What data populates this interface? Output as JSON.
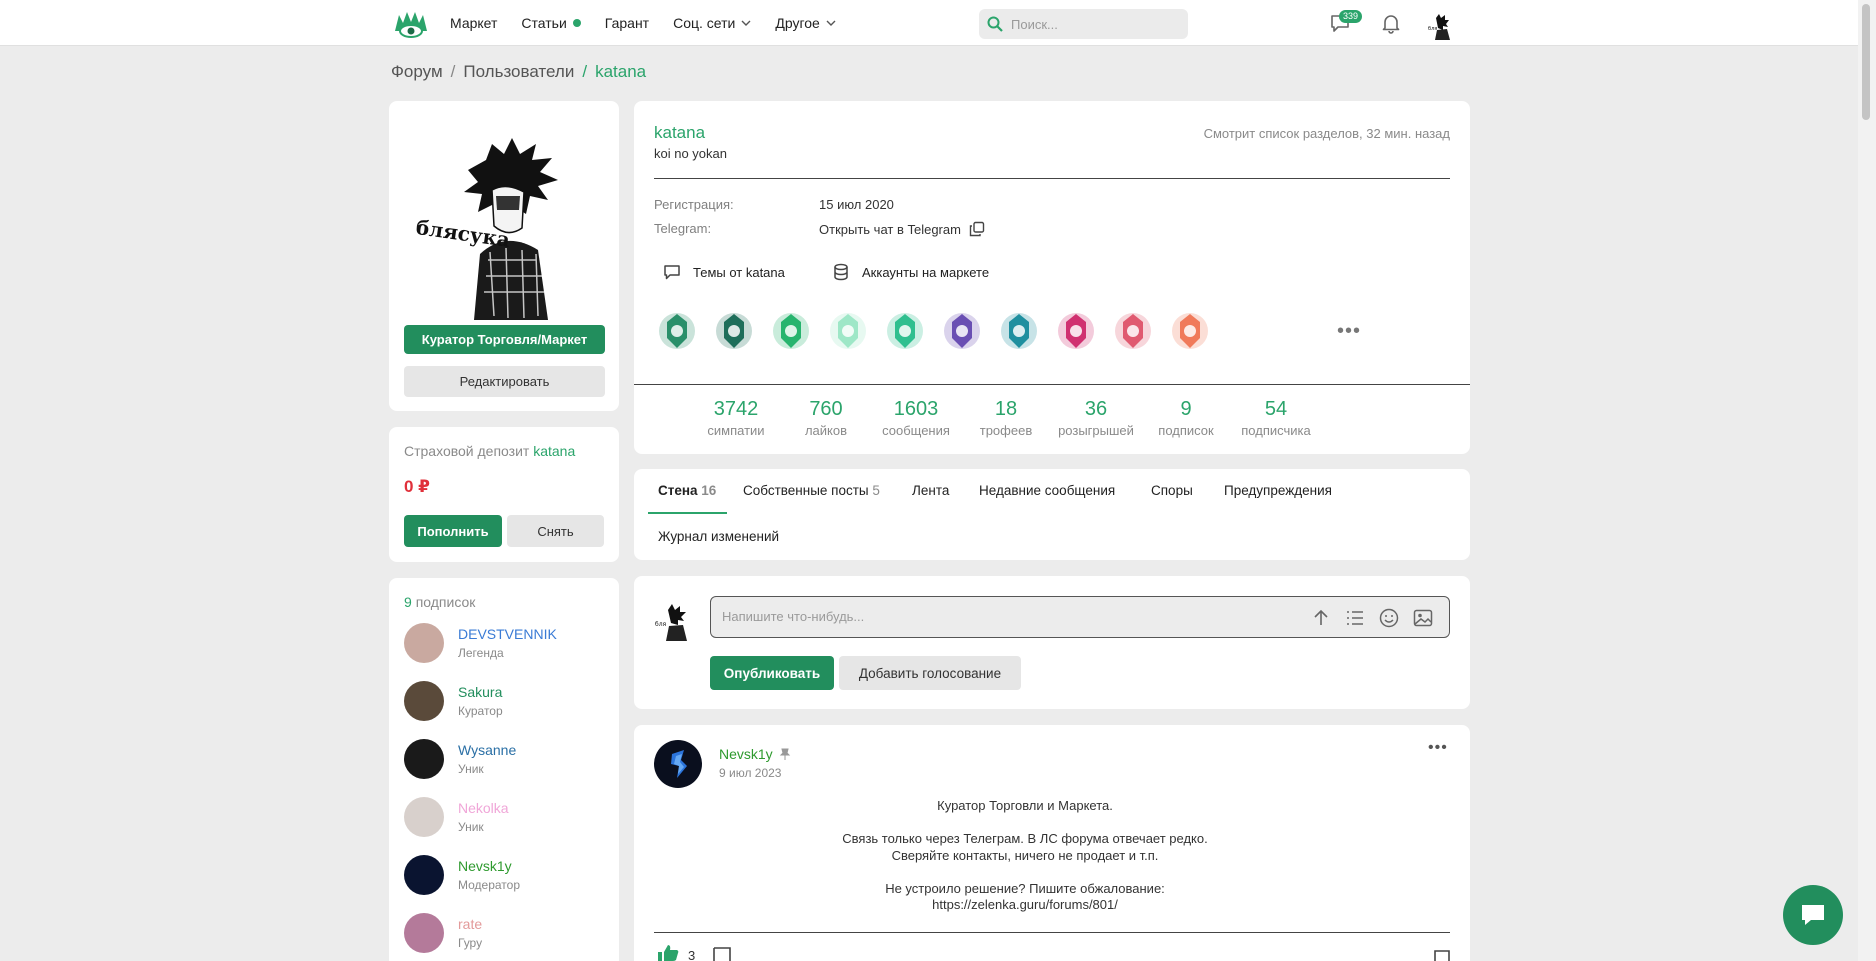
{
  "header": {
    "nav": [
      {
        "label": "Маркет",
        "dot": false,
        "chevron": false
      },
      {
        "label": "Статьи",
        "dot": true,
        "chevron": false
      },
      {
        "label": "Гарант",
        "dot": false,
        "chevron": false
      },
      {
        "label": "Соц. сети",
        "dot": false,
        "chevron": true
      },
      {
        "label": "Другое",
        "dot": false,
        "chevron": true
      }
    ],
    "search_placeholder": "Поиск...",
    "messages_badge": "339",
    "brand_color": "#2ba46b"
  },
  "breadcrumb": [
    "Форум",
    "/",
    "Пользователи",
    "/",
    "katana"
  ],
  "profile": {
    "username": "katana",
    "status": "koi no yokan",
    "activity": "Смотрит список разделов, 32 мин. назад",
    "role_button": "Куратор Торговля/Маркет",
    "edit_button": "Редактировать",
    "avatar_text": "блясука",
    "reg_label": "Регистрация:",
    "reg_value": "15 июл 2020",
    "tg_label": "Telegram:",
    "tg_value": "Открыть чат в Telegram",
    "link_topics": "Темы от katana",
    "link_market": "Аккаунты на маркете",
    "more": "•••"
  },
  "trophies": [
    {
      "name": "rainbow-six-trophy",
      "color": "#2a8f6a"
    },
    {
      "name": "year-trophy",
      "color": "#1e6e5a"
    },
    {
      "name": "three-years-trophy",
      "color": "#27b46e"
    },
    {
      "name": "lightbulb-trophy",
      "color": "#9ee7c7"
    },
    {
      "name": "drone-trophy",
      "color": "#2fbf8f"
    },
    {
      "name": "skull-trophy",
      "color": "#6a4fb3"
    },
    {
      "name": "planet-trophy",
      "color": "#1f8f9f"
    },
    {
      "name": "2k-trophy",
      "color": "#d03070"
    },
    {
      "name": "idea-trophy",
      "color": "#e05a70"
    },
    {
      "name": "flag-trophy",
      "color": "#f07a5a"
    }
  ],
  "stats": [
    {
      "value": "3742",
      "label": "симпатии"
    },
    {
      "value": "760",
      "label": "лайков"
    },
    {
      "value": "1603",
      "label": "сообщения"
    },
    {
      "value": "18",
      "label": "трофеев"
    },
    {
      "value": "36",
      "label": "розыгрышей"
    },
    {
      "value": "9",
      "label": "подписок"
    },
    {
      "value": "54",
      "label": "подписчика"
    }
  ],
  "deposit": {
    "title": "Страховой депозит",
    "user": "katana",
    "amount": "0 ₽",
    "topup": "Пополнить",
    "withdraw": "Снять"
  },
  "subscriptions": {
    "count": "9",
    "label": "подписок",
    "items": [
      {
        "name": "DEVSTVENNIK",
        "role": "Легенда",
        "color": "#3a7bd5",
        "av": "#c9a9a0"
      },
      {
        "name": "Sakura",
        "role": "Куратор",
        "color": "#228e5d",
        "av": "#5a4a3a"
      },
      {
        "name": "Wysanne",
        "role": "Уник",
        "color": "#2a6fa5",
        "av": "#1a1a1a"
      },
      {
        "name": "Nekolka",
        "role": "Уник",
        "color": "#f0a6d8",
        "av": "#d8d0cc"
      },
      {
        "name": "Nevsk1y",
        "role": "Модератор",
        "color": "#2e9a2e",
        "av": "#0a1430"
      },
      {
        "name": "rate",
        "role": "Гуру",
        "color": "#e39a9a",
        "av": "#b47a9a"
      }
    ]
  },
  "tabs": [
    {
      "label": "Стена",
      "count": "16",
      "active": true
    },
    {
      "label": "Собственные посты",
      "count": "5",
      "active": false
    },
    {
      "label": "Лента",
      "count": "",
      "active": false
    },
    {
      "label": "Недавние сообщения",
      "count": "",
      "active": false
    },
    {
      "label": "Споры",
      "count": "",
      "active": false
    },
    {
      "label": "Предупреждения",
      "count": "",
      "active": false
    },
    {
      "label": "Журнал изменений",
      "count": "",
      "active": false
    }
  ],
  "composer": {
    "placeholder": "Напишите что-нибудь...",
    "publish": "Опубликовать",
    "poll": "Добавить голосование"
  },
  "post": {
    "author": "Nevsk1y",
    "date": "9 июл 2023",
    "lines": [
      "Куратор Торговли и Маркета.",
      "",
      "Связь только через Телеграм. В ЛС форума отвечает редко.",
      "Сверяйте контакты, ничего не продает и т.п.",
      "",
      "Не устроило решение? Пишите обжалование:",
      "https://zelenka.guru/forums/801/"
    ],
    "likes": "3"
  }
}
